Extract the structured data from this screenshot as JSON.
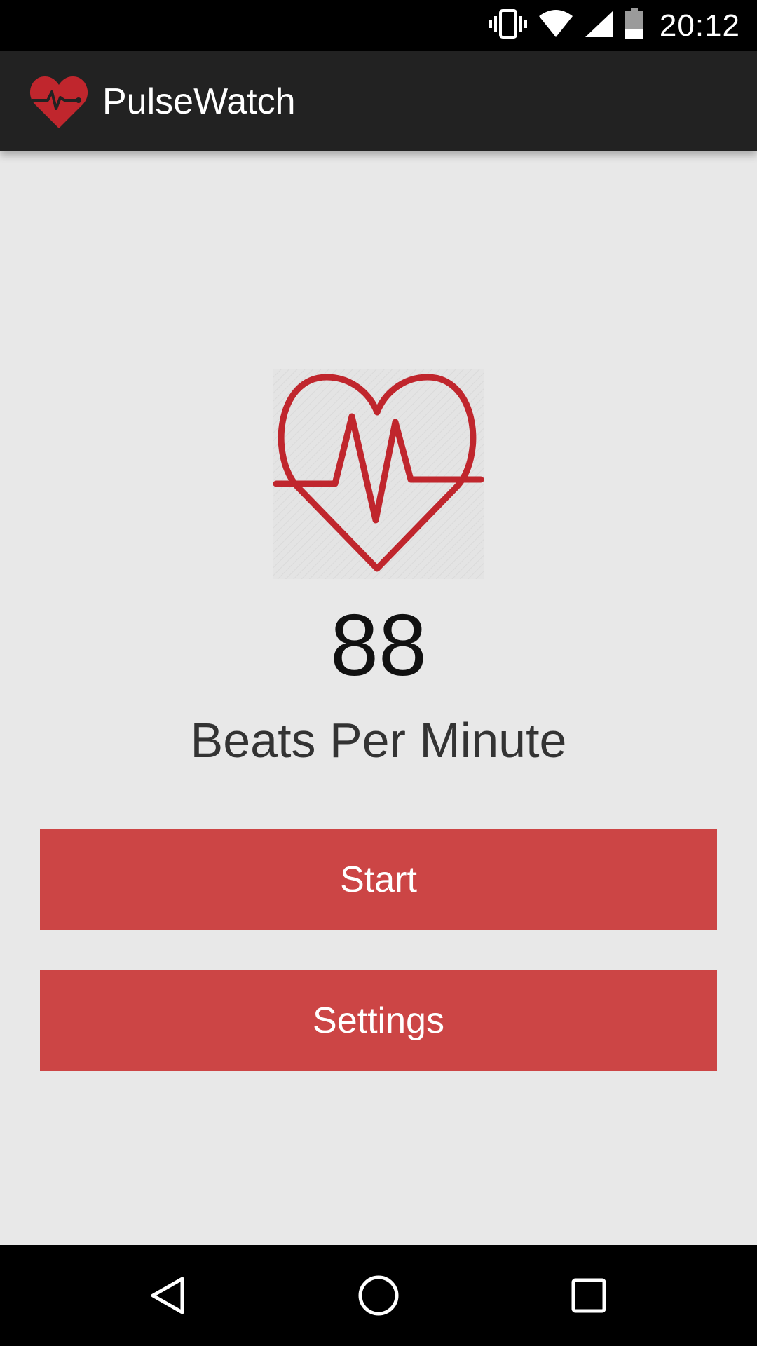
{
  "status_bar": {
    "time": "20:12",
    "icons": [
      "vibrate-icon",
      "wifi-icon",
      "cell-signal-icon",
      "battery-icon"
    ]
  },
  "app_bar": {
    "title": "PulseWatch",
    "logo_icon": "heart-pulse-logo-icon"
  },
  "main": {
    "heart_icon": "heart-pulse-icon",
    "bpm_value": "88",
    "bpm_label": "Beats Per Minute"
  },
  "actions": {
    "start_label": "Start",
    "settings_label": "Settings"
  },
  "nav_bar": {
    "icons": [
      "back-icon",
      "home-icon",
      "recents-icon"
    ]
  },
  "colors": {
    "accent": "#cc4545",
    "heart": "#c0262d",
    "app_bar": "#222222",
    "background": "#e8e8e8"
  }
}
